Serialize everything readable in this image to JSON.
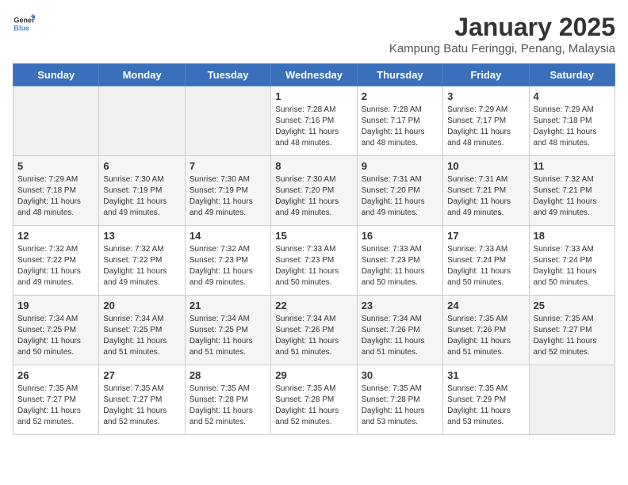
{
  "header": {
    "logo_general": "General",
    "logo_blue": "Blue",
    "month_title": "January 2025",
    "subtitle": "Kampung Batu Feringgi, Penang, Malaysia"
  },
  "days_of_week": [
    "Sunday",
    "Monday",
    "Tuesday",
    "Wednesday",
    "Thursday",
    "Friday",
    "Saturday"
  ],
  "weeks": [
    [
      {
        "day": "",
        "info": ""
      },
      {
        "day": "",
        "info": ""
      },
      {
        "day": "",
        "info": ""
      },
      {
        "day": "1",
        "info": "Sunrise: 7:28 AM\nSunset: 7:16 PM\nDaylight: 11 hours\nand 48 minutes."
      },
      {
        "day": "2",
        "info": "Sunrise: 7:28 AM\nSunset: 7:17 PM\nDaylight: 11 hours\nand 48 minutes."
      },
      {
        "day": "3",
        "info": "Sunrise: 7:29 AM\nSunset: 7:17 PM\nDaylight: 11 hours\nand 48 minutes."
      },
      {
        "day": "4",
        "info": "Sunrise: 7:29 AM\nSunset: 7:18 PM\nDaylight: 11 hours\nand 48 minutes."
      }
    ],
    [
      {
        "day": "5",
        "info": "Sunrise: 7:29 AM\nSunset: 7:18 PM\nDaylight: 11 hours\nand 48 minutes."
      },
      {
        "day": "6",
        "info": "Sunrise: 7:30 AM\nSunset: 7:19 PM\nDaylight: 11 hours\nand 49 minutes."
      },
      {
        "day": "7",
        "info": "Sunrise: 7:30 AM\nSunset: 7:19 PM\nDaylight: 11 hours\nand 49 minutes."
      },
      {
        "day": "8",
        "info": "Sunrise: 7:30 AM\nSunset: 7:20 PM\nDaylight: 11 hours\nand 49 minutes."
      },
      {
        "day": "9",
        "info": "Sunrise: 7:31 AM\nSunset: 7:20 PM\nDaylight: 11 hours\nand 49 minutes."
      },
      {
        "day": "10",
        "info": "Sunrise: 7:31 AM\nSunset: 7:21 PM\nDaylight: 11 hours\nand 49 minutes."
      },
      {
        "day": "11",
        "info": "Sunrise: 7:32 AM\nSunset: 7:21 PM\nDaylight: 11 hours\nand 49 minutes."
      }
    ],
    [
      {
        "day": "12",
        "info": "Sunrise: 7:32 AM\nSunset: 7:22 PM\nDaylight: 11 hours\nand 49 minutes."
      },
      {
        "day": "13",
        "info": "Sunrise: 7:32 AM\nSunset: 7:22 PM\nDaylight: 11 hours\nand 49 minutes."
      },
      {
        "day": "14",
        "info": "Sunrise: 7:32 AM\nSunset: 7:23 PM\nDaylight: 11 hours\nand 49 minutes."
      },
      {
        "day": "15",
        "info": "Sunrise: 7:33 AM\nSunset: 7:23 PM\nDaylight: 11 hours\nand 50 minutes."
      },
      {
        "day": "16",
        "info": "Sunrise: 7:33 AM\nSunset: 7:23 PM\nDaylight: 11 hours\nand 50 minutes."
      },
      {
        "day": "17",
        "info": "Sunrise: 7:33 AM\nSunset: 7:24 PM\nDaylight: 11 hours\nand 50 minutes."
      },
      {
        "day": "18",
        "info": "Sunrise: 7:33 AM\nSunset: 7:24 PM\nDaylight: 11 hours\nand 50 minutes."
      }
    ],
    [
      {
        "day": "19",
        "info": "Sunrise: 7:34 AM\nSunset: 7:25 PM\nDaylight: 11 hours\nand 50 minutes."
      },
      {
        "day": "20",
        "info": "Sunrise: 7:34 AM\nSunset: 7:25 PM\nDaylight: 11 hours\nand 51 minutes."
      },
      {
        "day": "21",
        "info": "Sunrise: 7:34 AM\nSunset: 7:25 PM\nDaylight: 11 hours\nand 51 minutes."
      },
      {
        "day": "22",
        "info": "Sunrise: 7:34 AM\nSunset: 7:26 PM\nDaylight: 11 hours\nand 51 minutes."
      },
      {
        "day": "23",
        "info": "Sunrise: 7:34 AM\nSunset: 7:26 PM\nDaylight: 11 hours\nand 51 minutes."
      },
      {
        "day": "24",
        "info": "Sunrise: 7:35 AM\nSunset: 7:26 PM\nDaylight: 11 hours\nand 51 minutes."
      },
      {
        "day": "25",
        "info": "Sunrise: 7:35 AM\nSunset: 7:27 PM\nDaylight: 11 hours\nand 52 minutes."
      }
    ],
    [
      {
        "day": "26",
        "info": "Sunrise: 7:35 AM\nSunset: 7:27 PM\nDaylight: 11 hours\nand 52 minutes."
      },
      {
        "day": "27",
        "info": "Sunrise: 7:35 AM\nSunset: 7:27 PM\nDaylight: 11 hours\nand 52 minutes."
      },
      {
        "day": "28",
        "info": "Sunrise: 7:35 AM\nSunset: 7:28 PM\nDaylight: 11 hours\nand 52 minutes."
      },
      {
        "day": "29",
        "info": "Sunrise: 7:35 AM\nSunset: 7:28 PM\nDaylight: 11 hours\nand 52 minutes."
      },
      {
        "day": "30",
        "info": "Sunrise: 7:35 AM\nSunset: 7:28 PM\nDaylight: 11 hours\nand 53 minutes."
      },
      {
        "day": "31",
        "info": "Sunrise: 7:35 AM\nSunset: 7:29 PM\nDaylight: 11 hours\nand 53 minutes."
      },
      {
        "day": "",
        "info": ""
      }
    ]
  ]
}
